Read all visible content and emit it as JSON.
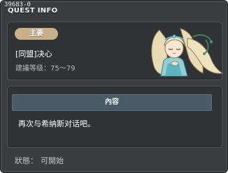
{
  "window": {
    "id_label": "39683-0",
    "title": "QUEST INFO"
  },
  "quest": {
    "type_badge": "主要",
    "name": "[同盟]决心",
    "level_label": "建議等级：",
    "level_value": "75～79",
    "npc_icon": "npc-portrait-elf-girl"
  },
  "content": {
    "header": "內容",
    "text": "再次与希纳斯对话吧。"
  },
  "status": {
    "label": "狀態：",
    "value": "可開始"
  },
  "colors": {
    "window_bg": "#3a3d40",
    "panel_bg": "#2f3336",
    "badge": "#c9b08b",
    "content_header": "#4a5a66"
  }
}
